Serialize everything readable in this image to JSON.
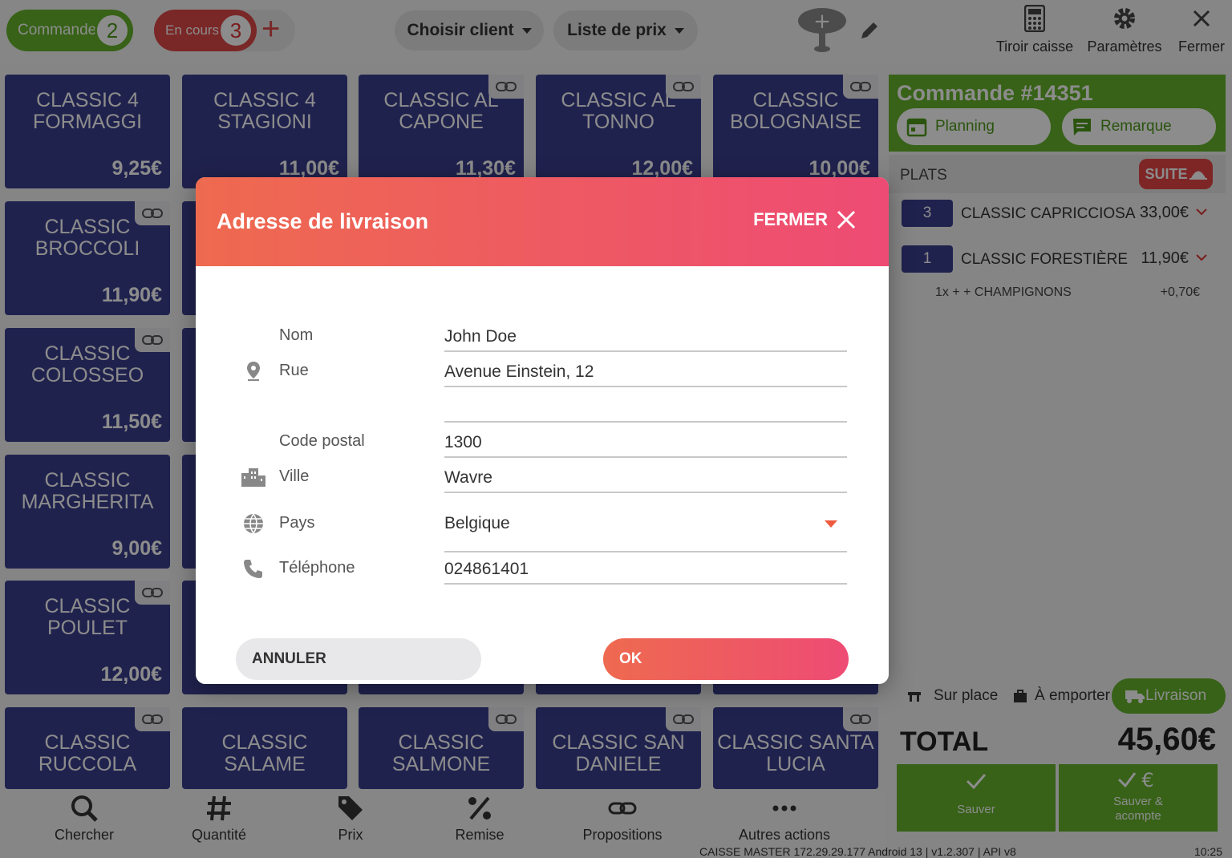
{
  "topbar": {
    "orders_label": "Commandes",
    "orders_count": "2",
    "in_progress_label": "En cours",
    "in_progress_count": "3",
    "add_symbol": "+",
    "choose_client": "Choisir client",
    "price_list": "Liste de prix",
    "actions": [
      {
        "label": "Tiroir caisse",
        "icon": "calculator-icon"
      },
      {
        "label": "Paramètres",
        "icon": "gear-icon"
      },
      {
        "label": "Fermer",
        "icon": "close-icon"
      }
    ]
  },
  "products": [
    {
      "name": "CLASSIC 4 FORMAGGI",
      "price": "9,25€",
      "linked": false
    },
    {
      "name": "CLASSIC 4 STAGIONI",
      "price": "11,00€",
      "linked": false
    },
    {
      "name": "CLASSIC AL CAPONE",
      "price": "11,30€",
      "linked": true
    },
    {
      "name": "CLASSIC AL TONNO",
      "price": "12,00€",
      "linked": true
    },
    {
      "name": "CLASSIC BOLOGNAISE",
      "price": "10,00€",
      "linked": true
    },
    {
      "name": "CLASSIC BROCCOLI",
      "price": "11,90€",
      "linked": true
    },
    {
      "name": "CLASSIC COLOSSEO",
      "price": "11,50€",
      "linked": true
    },
    {
      "name": "CLASSIC MARGHERITA",
      "price": "9,00€",
      "linked": false
    },
    {
      "name": "CLASSIC POULET",
      "price": "12,00€",
      "linked": true
    },
    {
      "name": "CLASSIC RUCCOLA",
      "price": "",
      "linked": true
    },
    {
      "name": "CLASSIC SALAME",
      "price": "",
      "linked": false
    },
    {
      "name": "CLASSIC SALMONE",
      "price": "",
      "linked": true
    },
    {
      "name": "CLASSIC SAN DANIELE",
      "price": "",
      "linked": true
    },
    {
      "name": "CLASSIC SANTA LUCIA",
      "price": "",
      "linked": true
    }
  ],
  "order": {
    "title": "Commande #14351",
    "planning": "Planning",
    "remark": "Remarque",
    "plats": "PLATS",
    "suite": "SUITE",
    "lines": [
      {
        "qty": "3",
        "name": "CLASSIC CAPRICCIOSA",
        "price": "33,00€"
      },
      {
        "qty": "1",
        "name": "CLASSIC FORESTIÈRE",
        "price": "11,90€"
      }
    ],
    "sub_line": {
      "name": "1x + + CHAMPIGNONS",
      "price": "+0,70€"
    },
    "modes": {
      "dine_in": "Sur place",
      "takeaway": "À emporter",
      "delivery": "Livraison"
    },
    "total_label": "TOTAL",
    "total_value": "45,60€",
    "save": "Sauver",
    "save_deposit": "Sauver & acompte"
  },
  "bottom": {
    "items": [
      {
        "label": "Chercher",
        "icon": "search-icon"
      },
      {
        "label": "Quantité",
        "icon": "hash-icon"
      },
      {
        "label": "Prix",
        "icon": "tags-icon"
      },
      {
        "label": "Remise",
        "icon": "percent-icon"
      },
      {
        "label": "Propositions",
        "icon": "link-icon"
      },
      {
        "label": "Autres actions",
        "icon": "more-icon"
      }
    ],
    "status": "CAISSE MASTER   172.29.29.177  Android 13  |  v1.2.307 | API v8",
    "clock": "10:25"
  },
  "modal": {
    "title": "Adresse de livraison",
    "close": "FERMER",
    "fields": {
      "nom": {
        "label": "Nom",
        "value": "John Doe"
      },
      "rue": {
        "label": "Rue",
        "value": "Avenue Einstein, 12"
      },
      "rue2": {
        "label": "",
        "value": ""
      },
      "code_postal": {
        "label": "Code postal",
        "value": "1300"
      },
      "ville": {
        "label": "Ville",
        "value": "Wavre"
      },
      "pays": {
        "label": "Pays",
        "value": "Belgique"
      },
      "telephone": {
        "label": "Téléphone",
        "value": "024861401"
      }
    },
    "cancel": "ANNULER",
    "ok": "OK"
  },
  "colors": {
    "green": "#64b32b",
    "navy": "#3b3f8e",
    "red": "#df4848",
    "gradient_start": "#ee6a4f",
    "gradient_end": "#ee4b74"
  }
}
